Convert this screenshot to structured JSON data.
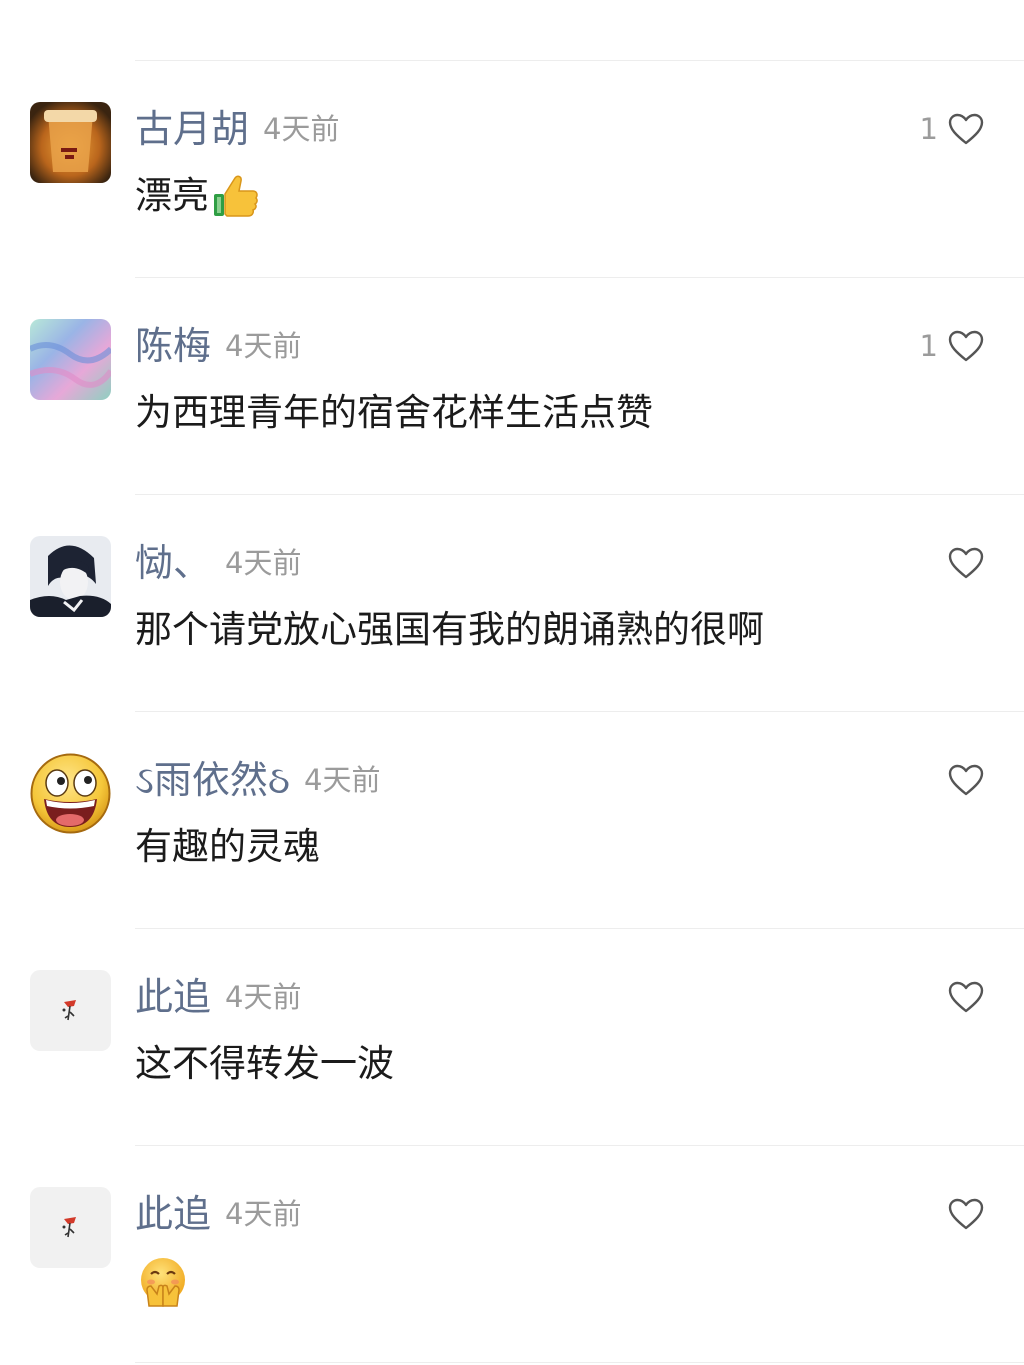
{
  "comments": [
    {
      "username": "古月胡",
      "time": "4天前",
      "text": "漂亮",
      "emoji": "thumbs-up-icon",
      "likes": "1"
    },
    {
      "username": "陈梅",
      "time": "4天前",
      "text": "为西理青年的宿舍花样生活点赞",
      "likes": "1"
    },
    {
      "username": "恸、",
      "time": "4天前",
      "text": "那个请党放心强国有我的朗诵熟的很啊",
      "likes": ""
    },
    {
      "username": "ઽ雨依然ઠ",
      "time": "4天前",
      "text": "有趣的灵魂",
      "likes": ""
    },
    {
      "username": "此追",
      "time": "4天前",
      "text": "这不得转发一波",
      "likes": ""
    },
    {
      "username": "此追",
      "time": "4天前",
      "text": "",
      "emoji": "face-with-hand-over-mouth-icon",
      "likes": ""
    }
  ],
  "colors": {
    "username": "#5f6f8c",
    "time": "#9b9b9b",
    "text": "#1b1b1b",
    "divider": "#ededed"
  }
}
